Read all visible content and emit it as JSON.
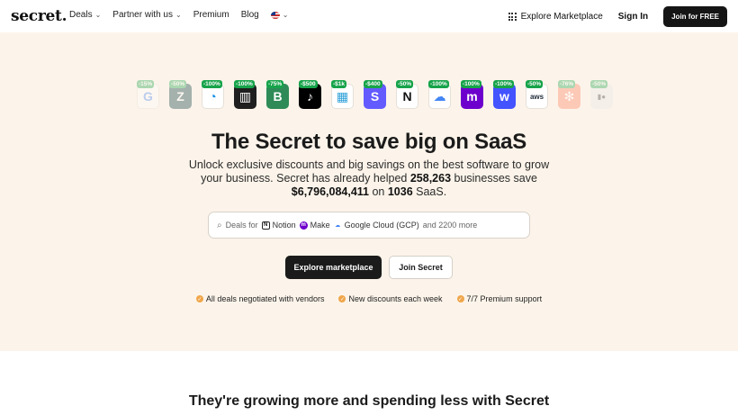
{
  "nav": {
    "logo": "secret.",
    "items": [
      {
        "label": "Deals",
        "dropdown": true
      },
      {
        "label": "Partner with us",
        "dropdown": true
      },
      {
        "label": "Premium",
        "dropdown": false
      },
      {
        "label": "Blog",
        "dropdown": false
      }
    ],
    "explore_label": "Explore Marketplace",
    "signin_label": "Sign In",
    "join_label": "Join for FREE"
  },
  "logos": [
    {
      "name": "google",
      "badge": "-15%",
      "glyph": "G",
      "bg": "#ffffff",
      "fg": "#4285F4",
      "faded": true
    },
    {
      "name": "zendesk",
      "badge": "-50%",
      "glyph": "Z",
      "bg": "#03363D",
      "fg": "#ffffff",
      "faded": true
    },
    {
      "name": "sendinblue",
      "badge": "-100%",
      "glyph": "◔",
      "bg": "#ffffff",
      "fg": "#1b8fe6",
      "faded": false
    },
    {
      "name": "intercom",
      "badge": "-100%",
      "glyph": "▥",
      "bg": "#1f1f1f",
      "fg": "#ffffff",
      "faded": false
    },
    {
      "name": "bubble",
      "badge": "-75%",
      "glyph": "B",
      "bg": "#2e8b57",
      "fg": "#ffffff",
      "faded": false
    },
    {
      "name": "tiktok",
      "badge": "-$500",
      "glyph": "♪",
      "bg": "#000000",
      "fg": "#ffffff",
      "faded": false
    },
    {
      "name": "brevo",
      "badge": "-$1k",
      "glyph": "▦",
      "bg": "#ffffff",
      "fg": "#2a9fd8",
      "faded": false
    },
    {
      "name": "stripe",
      "badge": "-$400",
      "glyph": "S",
      "bg": "#635bff",
      "fg": "#ffffff",
      "faded": false
    },
    {
      "name": "notion",
      "badge": "-50%",
      "glyph": "N",
      "bg": "#ffffff",
      "fg": "#111111",
      "faded": false
    },
    {
      "name": "google-cloud",
      "badge": "-100%",
      "glyph": "☁",
      "bg": "#ffffff",
      "fg": "#4285F4",
      "faded": false
    },
    {
      "name": "make",
      "badge": "-100%",
      "glyph": "m",
      "bg": "#6d00cc",
      "fg": "#ffffff",
      "faded": false
    },
    {
      "name": "webflow",
      "badge": "-100%",
      "glyph": "w",
      "bg": "#4353ff",
      "fg": "#ffffff",
      "faded": false
    },
    {
      "name": "aws",
      "badge": "-50%",
      "glyph": "aws",
      "bg": "#ffffff",
      "fg": "#232f3e",
      "faded": false
    },
    {
      "name": "hubspot",
      "badge": "-76%",
      "glyph": "✻",
      "bg": "#ff7a59",
      "fg": "#ffffff",
      "faded": true
    },
    {
      "name": "patreon",
      "badge": "-50%",
      "glyph": "▮●",
      "bg": "#e8e8e8",
      "fg": "#333333",
      "faded": true
    }
  ],
  "hero": {
    "headline": "The Secret to save big on SaaS",
    "sub_line1": "Unlock exclusive discounts and big savings on the best software to grow",
    "sub_line2a": "your business. Secret has already helped ",
    "businesses": "258,263",
    "sub_line2b": " businesses save",
    "savings": "$6,796,084,411",
    "sub_line3a": " on ",
    "saas_count": "1036",
    "sub_line3b": " SaaS."
  },
  "search": {
    "prefix": "Deals for",
    "chips": [
      {
        "label": "Notion",
        "glyph": "N",
        "bg": "#ffffff",
        "fg": "#111111"
      },
      {
        "label": "Make",
        "glyph": "m",
        "bg": "#6d00cc",
        "fg": "#ffffff"
      },
      {
        "label": "Google Cloud (GCP)",
        "glyph": "☁",
        "bg": "#ffffff",
        "fg": "#4285F4"
      }
    ],
    "suffix": "and 2200 more"
  },
  "cta": {
    "primary": "Explore marketplace",
    "secondary": "Join Secret"
  },
  "features": [
    "All deals negotiated with vendors",
    "New discounts each week",
    "7/7 Premium support"
  ],
  "section": {
    "title": "They're growing more and spending less with Secret"
  }
}
